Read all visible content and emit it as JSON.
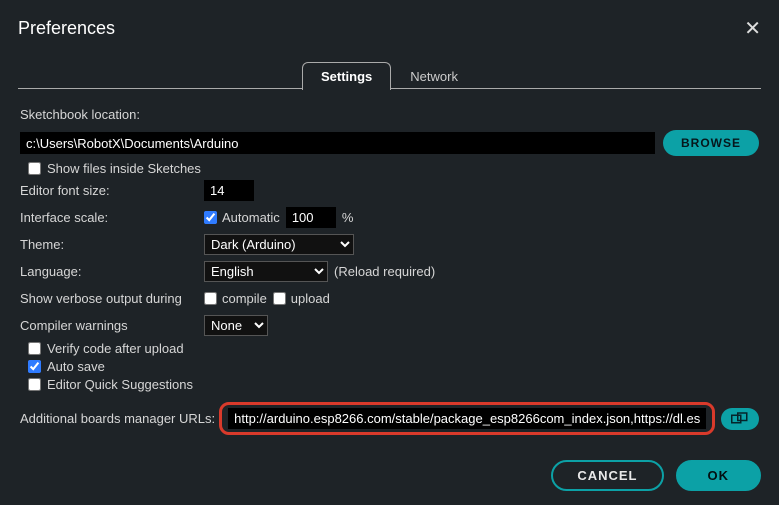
{
  "title": "Preferences",
  "tabs": {
    "settings": "Settings",
    "network": "Network"
  },
  "labels": {
    "sketchbook": "Sketchbook location:",
    "show_files": "Show files inside Sketches",
    "editor_font": "Editor font size:",
    "iface_scale": "Interface scale:",
    "automatic": "Automatic",
    "pct": "%",
    "theme": "Theme:",
    "language": "Language:",
    "reload": "(Reload required)",
    "verbose": "Show verbose output during",
    "compile": "compile",
    "upload": "upload",
    "warnings": "Compiler warnings",
    "verify": "Verify code after upload",
    "autosave": "Auto save",
    "quicksugg": "Editor Quick Suggestions",
    "add_urls": "Additional boards manager URLs:"
  },
  "values": {
    "sketchbook": "c:\\Users\\RobotX\\Documents\\Arduino",
    "font_size": "14",
    "scale_pct": "100",
    "theme": "Dark (Arduino)",
    "language": "English",
    "warnings": "None",
    "add_urls": "http://arduino.esp8266.com/stable/package_esp8266com_index.json,https://dl.es"
  },
  "checks": {
    "show_files": false,
    "automatic": true,
    "compile": false,
    "upload": false,
    "verify": false,
    "autosave": true,
    "quicksugg": false
  },
  "buttons": {
    "browse": "BROWSE",
    "cancel": "CANCEL",
    "ok": "OK"
  }
}
